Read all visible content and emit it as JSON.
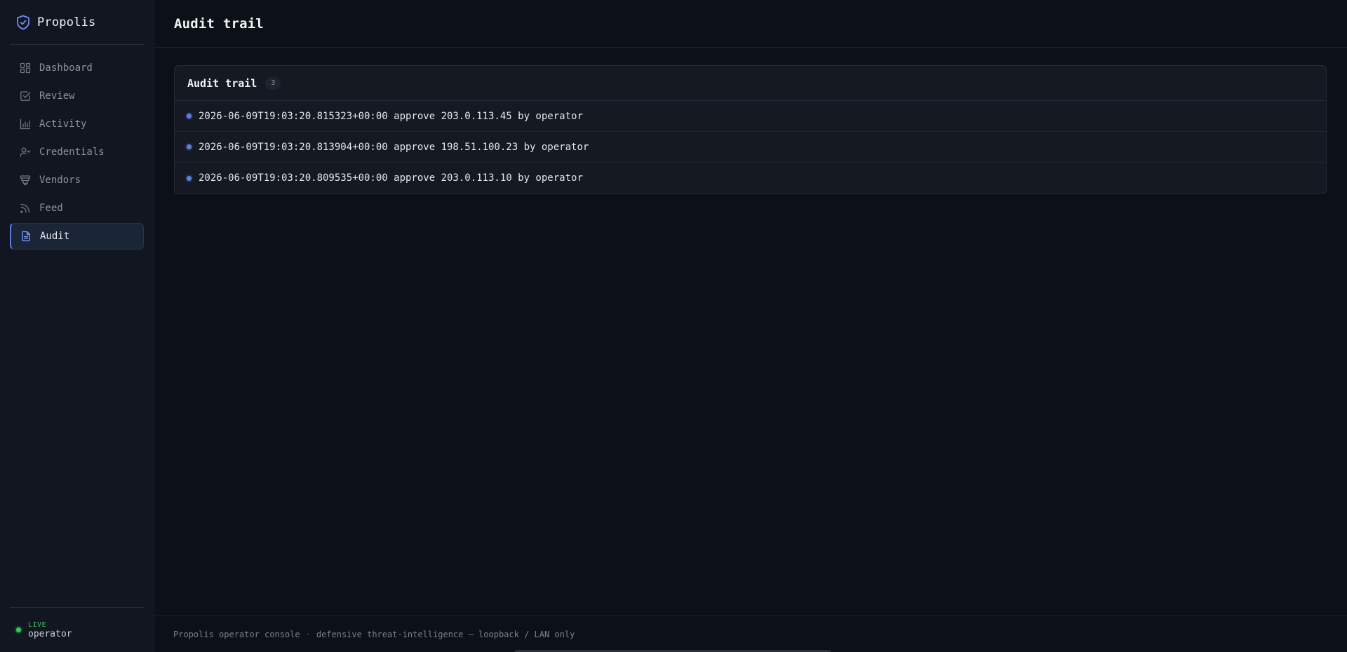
{
  "sidebar": {
    "brand": "Propolis",
    "items": [
      {
        "label": "Dashboard",
        "icon": "dashboard-icon"
      },
      {
        "label": "Review",
        "icon": "check-square-icon"
      },
      {
        "label": "Activity",
        "icon": "bar-chart-icon"
      },
      {
        "label": "Credentials",
        "icon": "user-key-icon"
      },
      {
        "label": "Vendors",
        "icon": "filter-stack-icon"
      },
      {
        "label": "Feed",
        "icon": "rss-icon"
      },
      {
        "label": "Audit",
        "icon": "document-icon",
        "active": true
      }
    ],
    "status": {
      "label": "LIVE",
      "user": "operator"
    }
  },
  "header": {
    "title": "Audit trail"
  },
  "audit": {
    "title": "Audit trail",
    "count": "3",
    "entries": [
      "2026-06-09T19:03:20.815323+00:00 approve 203.0.113.45 by operator",
      "2026-06-09T19:03:20.813904+00:00 approve 198.51.100.23 by operator",
      "2026-06-09T19:03:20.809535+00:00 approve 203.0.113.10 by operator"
    ]
  },
  "footer": {
    "left": "Propolis operator console",
    "separator": "·",
    "right": "defensive threat-intelligence — loopback / LAN only"
  },
  "colors": {
    "accent": "#5b7fe0",
    "live": "#34c759",
    "background": "#0c1017"
  }
}
